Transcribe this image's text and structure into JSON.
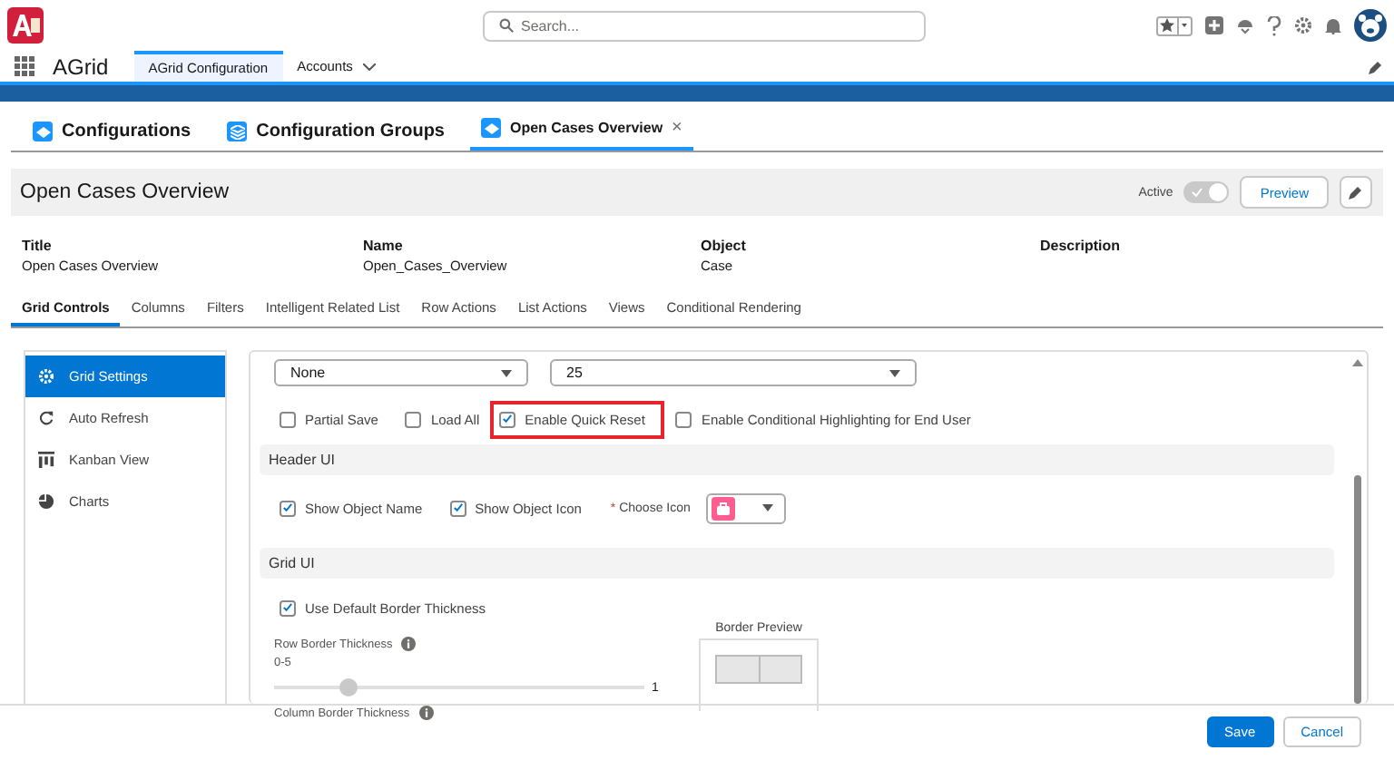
{
  "header": {
    "search": {
      "placeholder": "Search..."
    }
  },
  "nav": {
    "app_name": "AGrid",
    "tabs": [
      {
        "label": "AGrid Configuration",
        "selected": true,
        "kind": "plain"
      },
      {
        "label": "Accounts",
        "selected": false,
        "kind": "menu"
      }
    ]
  },
  "workspace_tabs": [
    {
      "label": "Configurations",
      "selected": false,
      "kind": "record"
    },
    {
      "label": "Configuration Groups",
      "selected": false,
      "kind": "group"
    },
    {
      "label": "Open Cases Overview",
      "selected": true,
      "kind": "record",
      "close": "×"
    }
  ],
  "page_header": {
    "title": "Open Cases Overview",
    "toggle": {
      "label": "Active",
      "on": true,
      "disabled": true
    },
    "buttons": [
      "Preview"
    ]
  },
  "details": [
    {
      "label": "Title",
      "value": "Open Cases Overview"
    },
    {
      "label": "Name",
      "value": "Open_Cases_Overview"
    },
    {
      "label": "Object",
      "value": "Case"
    },
    {
      "label": "Description"
    }
  ],
  "sub_tabs": [
    {
      "label": "Grid Controls",
      "selected": true
    },
    {
      "label": "Columns",
      "selected": false
    },
    {
      "label": "Filters",
      "selected": false
    },
    {
      "label": "Intelligent Related List",
      "selected": false
    },
    {
      "label": "Row Actions",
      "selected": false
    },
    {
      "label": "List Actions",
      "selected": false
    },
    {
      "label": "Views",
      "selected": false
    },
    {
      "label": "Conditional Rendering",
      "selected": false
    }
  ],
  "sidebar": {
    "items": [
      {
        "label": "Grid Settings",
        "selected": true,
        "kind": "gear"
      },
      {
        "label": "Auto Refresh",
        "selected": false,
        "kind": "refresh"
      },
      {
        "label": "Kanban View",
        "selected": false,
        "kind": "kanban"
      },
      {
        "label": "Charts",
        "selected": false,
        "kind": "chart"
      }
    ]
  },
  "settings": {
    "dropdowns": [
      {
        "value": "None"
      },
      {
        "value": "25"
      }
    ],
    "options": [
      {
        "label": "Partial Save",
        "checked": false,
        "highlighted": false
      },
      {
        "label": "Load All",
        "checked": false,
        "highlighted": false
      },
      {
        "label": "Enable Quick Reset",
        "checked": true,
        "highlighted": true
      },
      {
        "label": "Enable Conditional Highlighting for End User",
        "checked": false,
        "highlighted": false
      }
    ],
    "header_ui": {
      "title": "Header UI",
      "options": [
        {
          "label": "Show Object Name",
          "checked": true
        },
        {
          "label": "Show Object Icon",
          "checked": true
        }
      ],
      "icon_picker": {
        "label": "Choose Icon",
        "required_mark": "*"
      }
    },
    "grid_ui": {
      "title": "Grid UI",
      "options": [
        {
          "label": "Use Default Border Thickness",
          "checked": true
        }
      ],
      "sliders": [
        {
          "label": "Row Border Thickness",
          "range": "0-5",
          "level": 0.2,
          "reading": "1"
        },
        {
          "label": "Column Border Thickness"
        }
      ],
      "preview_title": "Border Preview"
    }
  },
  "footer": {
    "buttons": [
      {
        "label": "Save",
        "kind": "brand"
      },
      {
        "label": "Cancel",
        "kind": "neutral"
      }
    ]
  }
}
